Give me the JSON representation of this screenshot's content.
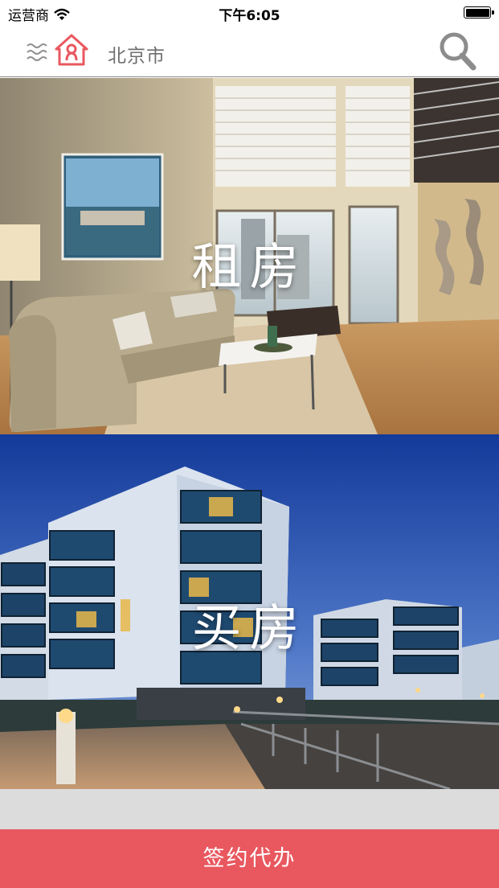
{
  "status_bar": {
    "carrier": "运营商",
    "time": "下午6:05",
    "icons": [
      "wifi-icon",
      "battery-icon"
    ]
  },
  "nav": {
    "city": "北京市",
    "icons": [
      "menu-icon",
      "home-logo-icon",
      "search-icon"
    ]
  },
  "banners": {
    "rent": "租房",
    "buy": "买房"
  },
  "footer": {
    "sign_button": "签约代办"
  },
  "colors": {
    "accent": "#e9585f",
    "gap": "#dcdcdc",
    "city_text": "#6f6f6f"
  }
}
